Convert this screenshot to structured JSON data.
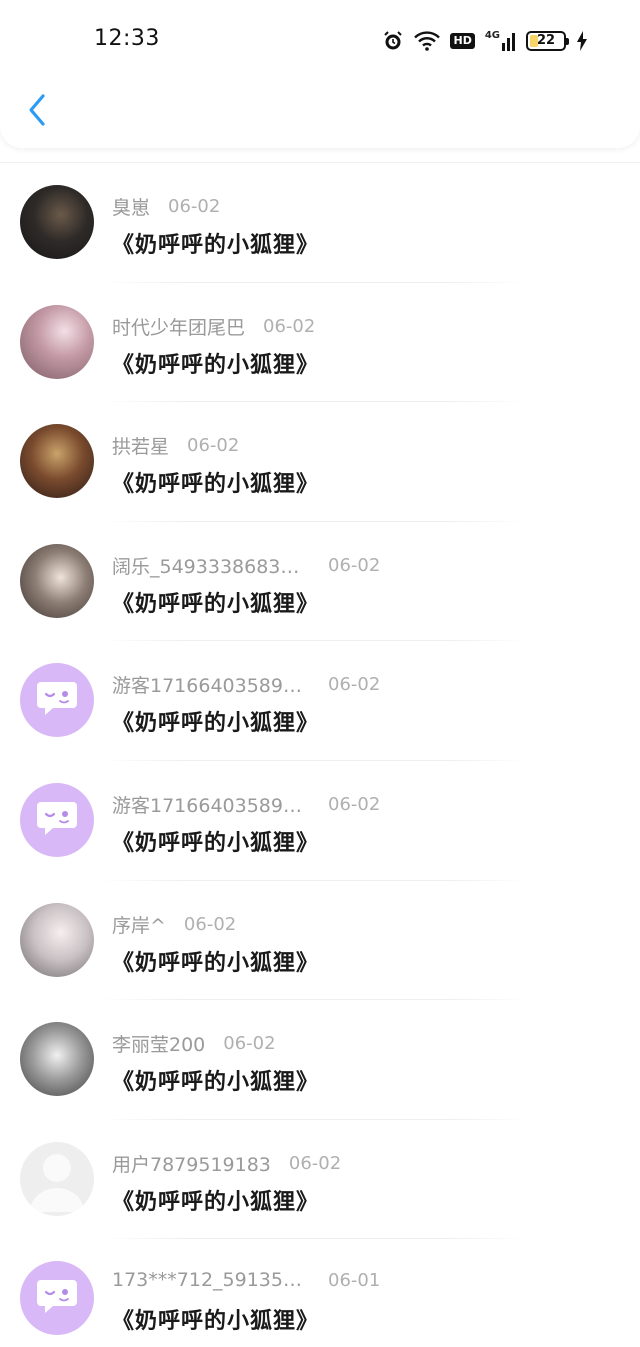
{
  "status_bar": {
    "time": "12:33",
    "network_label": "HD",
    "network_gen": "4G",
    "battery_level": "22",
    "icons": [
      "alarm-icon",
      "wifi-icon",
      "hd-icon",
      "signal-4g-icon",
      "battery-icon",
      "charging-icon"
    ]
  },
  "header": {
    "back_icon": "chevron-left-icon",
    "accent_color": "#2b9bf4"
  },
  "items": [
    {
      "name": "臭崽",
      "date": "06-02",
      "title": "《奶呼呼的小狐狸》",
      "avatar": "photo"
    },
    {
      "name": "时代少年团尾巴",
      "date": "06-02",
      "title": "《奶呼呼的小狐狸》",
      "avatar": "photo"
    },
    {
      "name": "拱若星",
      "date": "06-02",
      "title": "《奶呼呼的小狐狸》",
      "avatar": "photo"
    },
    {
      "name": "阔乐_5493338683…",
      "date": "06-02",
      "title": "《奶呼呼的小狐狸》",
      "avatar": "photo"
    },
    {
      "name": "游客171664035892…",
      "date": "06-02",
      "title": "《奶呼呼的小狐狸》",
      "avatar": "bot"
    },
    {
      "name": "游客171664035892…",
      "date": "06-02",
      "title": "《奶呼呼的小狐狸》",
      "avatar": "bot"
    },
    {
      "name": "序岸^",
      "date": "06-02",
      "title": "《奶呼呼的小狐狸》",
      "avatar": "photo"
    },
    {
      "name": "李丽莹200",
      "date": "06-02",
      "title": "《奶呼呼的小狐狸》",
      "avatar": "photo"
    },
    {
      "name": "用户7879519183",
      "date": "06-02",
      "title": "《奶呼呼的小狐狸》",
      "avatar": "default"
    },
    {
      "name": "173***712_591359…",
      "date": "06-01",
      "title": "《奶呼呼的小狐狸》",
      "avatar": "bot"
    }
  ]
}
